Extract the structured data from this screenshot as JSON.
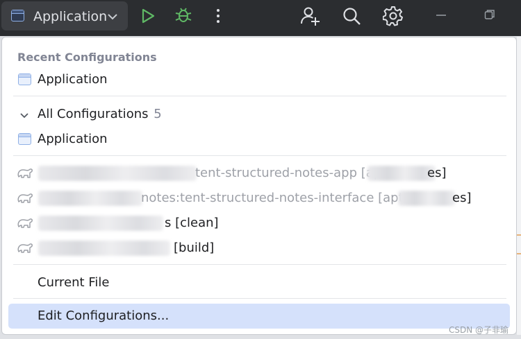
{
  "toolbar": {
    "run_config_label": "Application",
    "icons": [
      "run-icon",
      "debug-icon",
      "more-vertical-icon",
      "add-user-icon",
      "search-icon",
      "settings-gear-icon",
      "minimize-icon",
      "restore-icon"
    ]
  },
  "popup": {
    "recent_header": "Recent Configurations",
    "recent_items": [
      {
        "label": "Application",
        "icon": "application-config-icon"
      }
    ],
    "all_configs_label": "All Configurations",
    "all_configs_count": "5",
    "all_items": [
      {
        "label": "Application",
        "icon": "application-config-icon"
      }
    ],
    "gradle_tasks": [
      {
        "visible_text": "tent-structured-notes-app [ap",
        "visible_suffix": "es]"
      },
      {
        "visible_text": "notes:tent-structured-notes-interface [apt",
        "visible_suffix": "es]"
      },
      {
        "visible_text": "s [clean]"
      },
      {
        "visible_text": "[build]"
      }
    ],
    "current_file_label": "Current File",
    "edit_configs_label": "Edit Configurations..."
  },
  "watermark": "CSDN @子非瑜",
  "colors": {
    "toolbar_bg": "#2b2d30",
    "run_green": "#5fb865",
    "highlight": "#d5e1fb",
    "muted_text": "#818594"
  }
}
